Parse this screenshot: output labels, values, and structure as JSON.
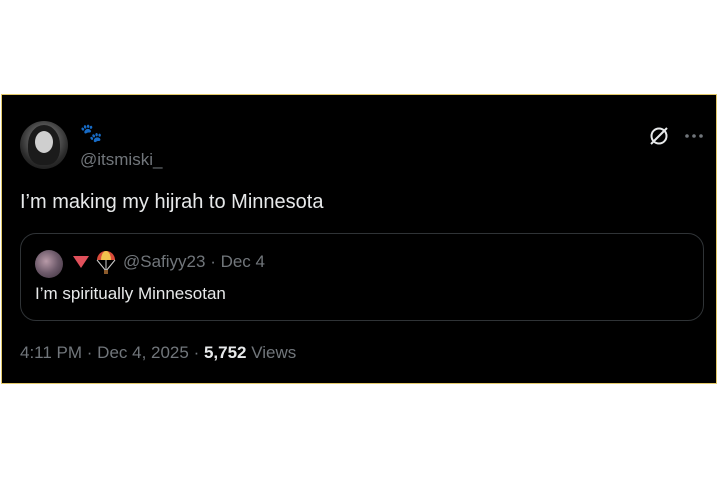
{
  "tweet": {
    "author_handle": "@itsmiski_",
    "author_badge_icon": "paw-prints-icon",
    "text": "I’m making my hijrah to Minnesota",
    "time": "4:11 PM",
    "separator": " · ",
    "date": "Dec 4, 2025",
    "views_count": "5,752",
    "views_label": "Views"
  },
  "quote": {
    "handle": "@Safiyy23",
    "date": "Dec 4",
    "text": "I’m spiritually Minnesotan",
    "badge_icons": [
      "red-triangle-icon",
      "parachute-icon"
    ]
  },
  "actions": {
    "grok_icon": "grok-icon",
    "more_icon": "more-icon"
  },
  "colors": {
    "background": "#000000",
    "border": "#e3c96a",
    "primary_text": "#e7e9ea",
    "secondary_text": "#71767b",
    "quote_border": "#2f3336"
  }
}
